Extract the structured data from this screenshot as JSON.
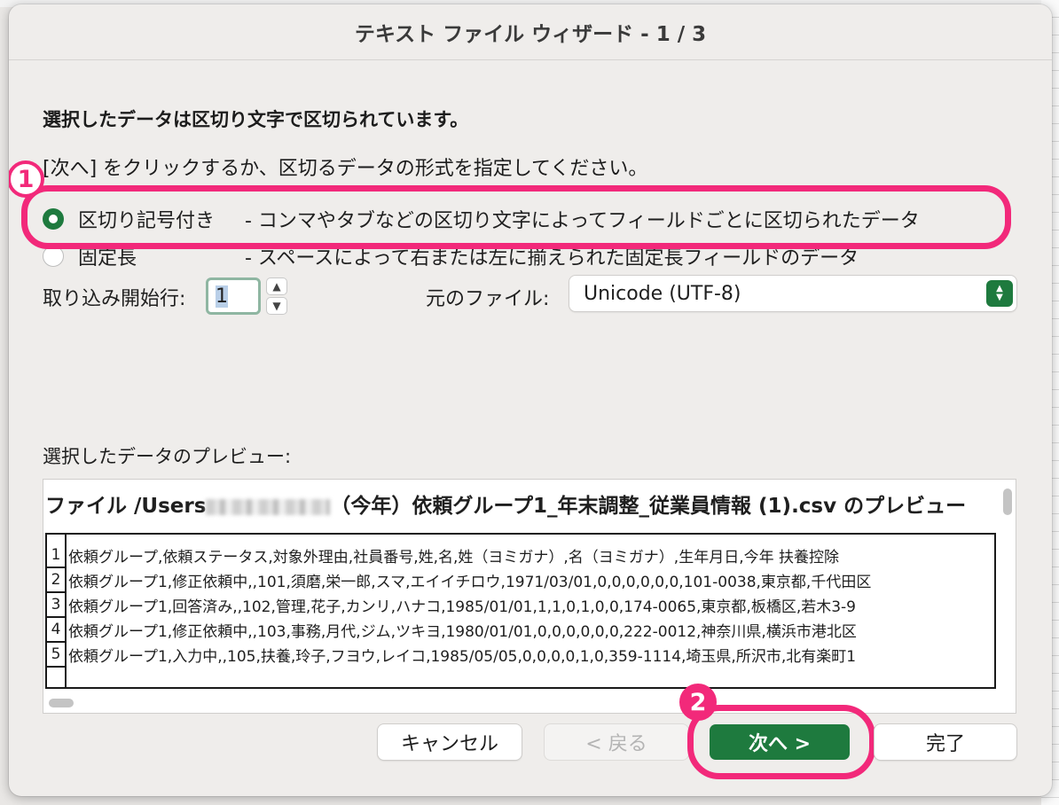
{
  "dialog": {
    "title": "テキスト ファイル ウィザード - 1 / 3",
    "heading": "選択したデータは区切り文字で区切られています。",
    "instruction": "[次へ] をクリックするか、区切るデータの形式を指定してください。"
  },
  "options": [
    {
      "label": "区切り記号付き",
      "description": "- コンマやタブなどの区切り文字によってフィールドごとに区切られたデータ",
      "selected": true
    },
    {
      "label": "固定長",
      "description": "- スペースによって右または左に揃えられた固定長フィールドのデータ",
      "selected": false
    }
  ],
  "start_row": {
    "label": "取り込み開始行:",
    "value": "1"
  },
  "origin": {
    "label": "元のファイル:",
    "value": "Unicode (UTF-8)"
  },
  "preview": {
    "label": "選択したデータのプレビュー:",
    "title_prefix": "ファイル /Users",
    "title_suffix": "（今年）依頼グループ1_年末調整_従業員情報 (1).csv のプレビュー",
    "rows": [
      {
        "num": "1",
        "text": "依頼グループ,依頼ステータス,対象外理由,社員番号,姓,名,姓（ヨミガナ）,名（ヨミガナ）,生年月日,今年 扶養控除"
      },
      {
        "num": "2",
        "text": "依頼グループ1,修正依頼中,,101,須磨,栄一郎,スマ,エイイチロウ,1971/03/01,0,0,0,0,0,0,101-0038,東京都,千代田区"
      },
      {
        "num": "3",
        "text": "依頼グループ1,回答済み,,102,管理,花子,カンリ,ハナコ,1985/01/01,1,1,0,1,0,0,174-0065,東京都,板橋区,若木3-9"
      },
      {
        "num": "4",
        "text": "依頼グループ1,修正依頼中,,103,事務,月代,ジム,ツキヨ,1980/01/01,0,0,0,0,0,0,222-0012,神奈川県,横浜市港北区"
      },
      {
        "num": "5",
        "text": "依頼グループ1,入力中,,105,扶養,玲子,フヨウ,レイコ,1985/05/05,0,0,0,0,1,0,359-1114,埼玉県,所沢市,北有楽町1"
      }
    ]
  },
  "buttons": {
    "cancel": "キャンセル",
    "back": "< 戻る",
    "next": "次へ >",
    "finish": "完了"
  },
  "annotations": {
    "badge1": "1",
    "badge2": "2"
  },
  "colors": {
    "accent": "#1e7a3e",
    "annotation": "#f2297a"
  }
}
